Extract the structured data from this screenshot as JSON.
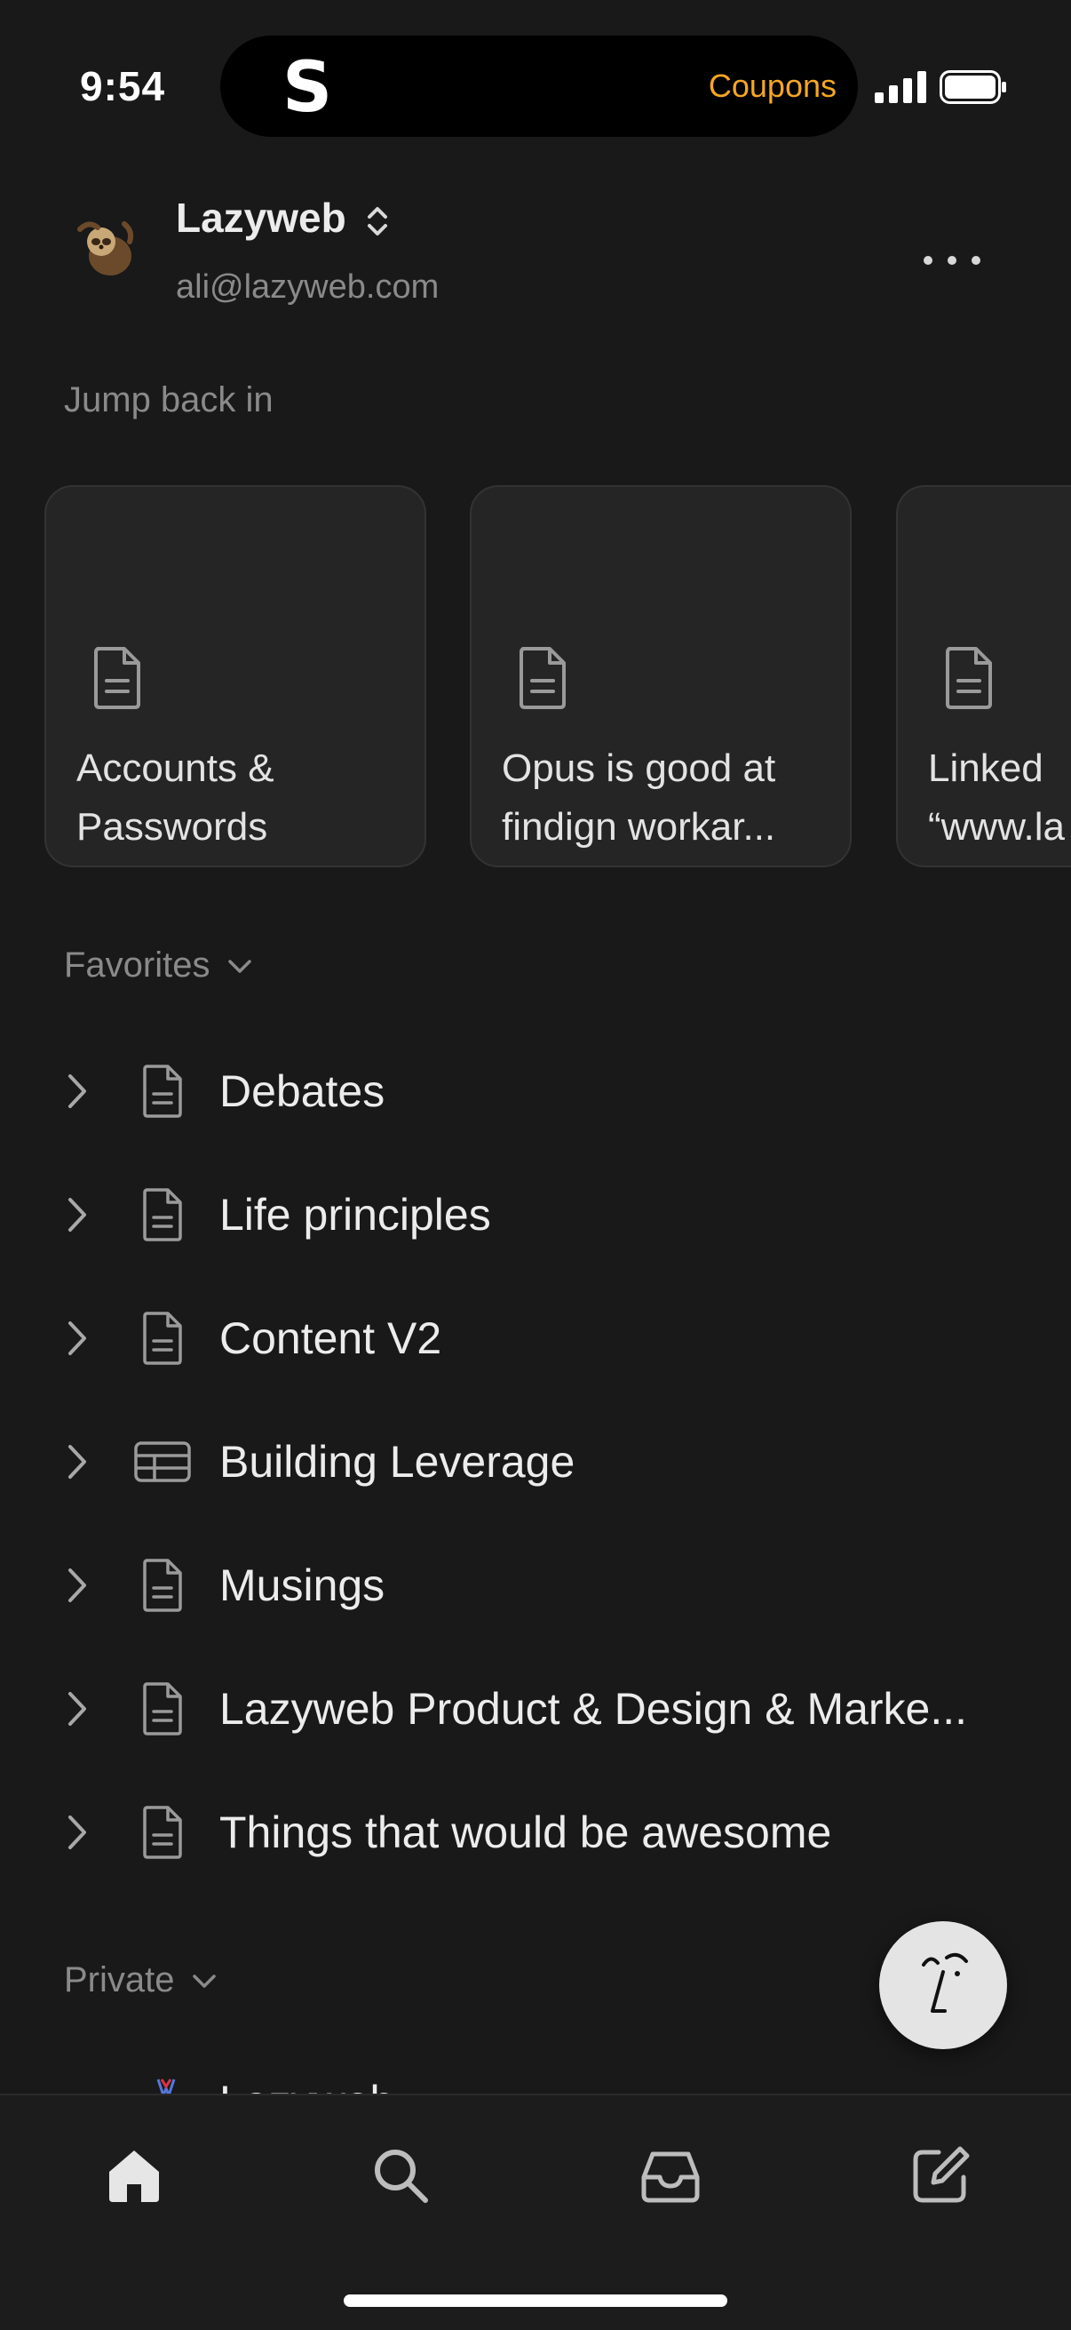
{
  "status_bar": {
    "time": "9:54",
    "island_logo": "S",
    "island_link": "Coupons"
  },
  "header": {
    "workspace_name": "Lazyweb",
    "email": "ali@lazyweb.com",
    "avatar_icon": "sloth-avatar",
    "switcher_icon": "chevron-up-down-icon",
    "more_icon": "more-horizontal-icon"
  },
  "jump_back_in": {
    "title": "Jump back in",
    "cards": [
      {
        "line1": "Accounts &",
        "line2": "Passwords",
        "icon": "document-icon"
      },
      {
        "line1": "Opus is good at",
        "line2": "findign workar...",
        "icon": "document-icon"
      },
      {
        "line1": "Linked",
        "line2": "“www.la",
        "icon": "document-icon"
      }
    ]
  },
  "favorites": {
    "title": "Favorites",
    "items": [
      {
        "label": "Debates",
        "icon": "document-icon"
      },
      {
        "label": "Life principles",
        "icon": "document-icon"
      },
      {
        "label": "Content V2",
        "icon": "document-icon"
      },
      {
        "label": "Building Leverage",
        "icon": "table-icon"
      },
      {
        "label": "Musings",
        "icon": "document-icon"
      },
      {
        "label": "Lazyweb Product & Design & Marke...",
        "icon": "document-icon"
      },
      {
        "label": "Things that would be awesome",
        "icon": "document-icon"
      }
    ]
  },
  "private": {
    "title": "Private",
    "peek_item": "Lazyweb"
  },
  "fab": {
    "icon": "notion-ai-face-icon"
  },
  "tabbar": {
    "tabs": [
      {
        "name": "home",
        "icon": "home-icon"
      },
      {
        "name": "search",
        "icon": "search-icon"
      },
      {
        "name": "inbox",
        "icon": "inbox-icon"
      },
      {
        "name": "new-page",
        "icon": "compose-icon"
      }
    ]
  },
  "colors": {
    "background": "#191919",
    "card": "#252525",
    "accent_coupons": "#f5a623",
    "muted_text": "#8a8a8a"
  }
}
